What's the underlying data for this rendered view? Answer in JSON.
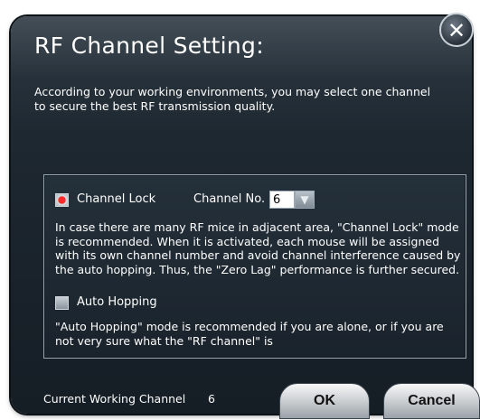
{
  "dialog": {
    "title": "RF Channel Setting:",
    "description": "According to your working environments, you may select one channel to secure the best RF transmission quality."
  },
  "channel_lock": {
    "label": "Channel Lock",
    "checked": true,
    "channel_no_label": "Channel No.",
    "channel_value": "6",
    "description": "In case there are many RF mice in adjacent area, \"Channel Lock\" mode is recommended. When it is activated, each mouse will be assigned with its own channel number and avoid channel interference caused by the auto hopping. Thus, the \"Zero Lag\" performance is further secured."
  },
  "auto_hopping": {
    "label": "Auto Hopping",
    "checked": false,
    "description": "\"Auto Hopping\" mode is recommended if you are alone, or if you are not very sure what the \"RF channel\" is"
  },
  "status": {
    "label": "Current Working Channel",
    "value": "6"
  },
  "buttons": {
    "ok": "OK",
    "cancel": "Cancel",
    "close": "✕"
  },
  "colors": {
    "dialog_bg": "#1e2831",
    "accent_checked": "#ff2a2a"
  }
}
